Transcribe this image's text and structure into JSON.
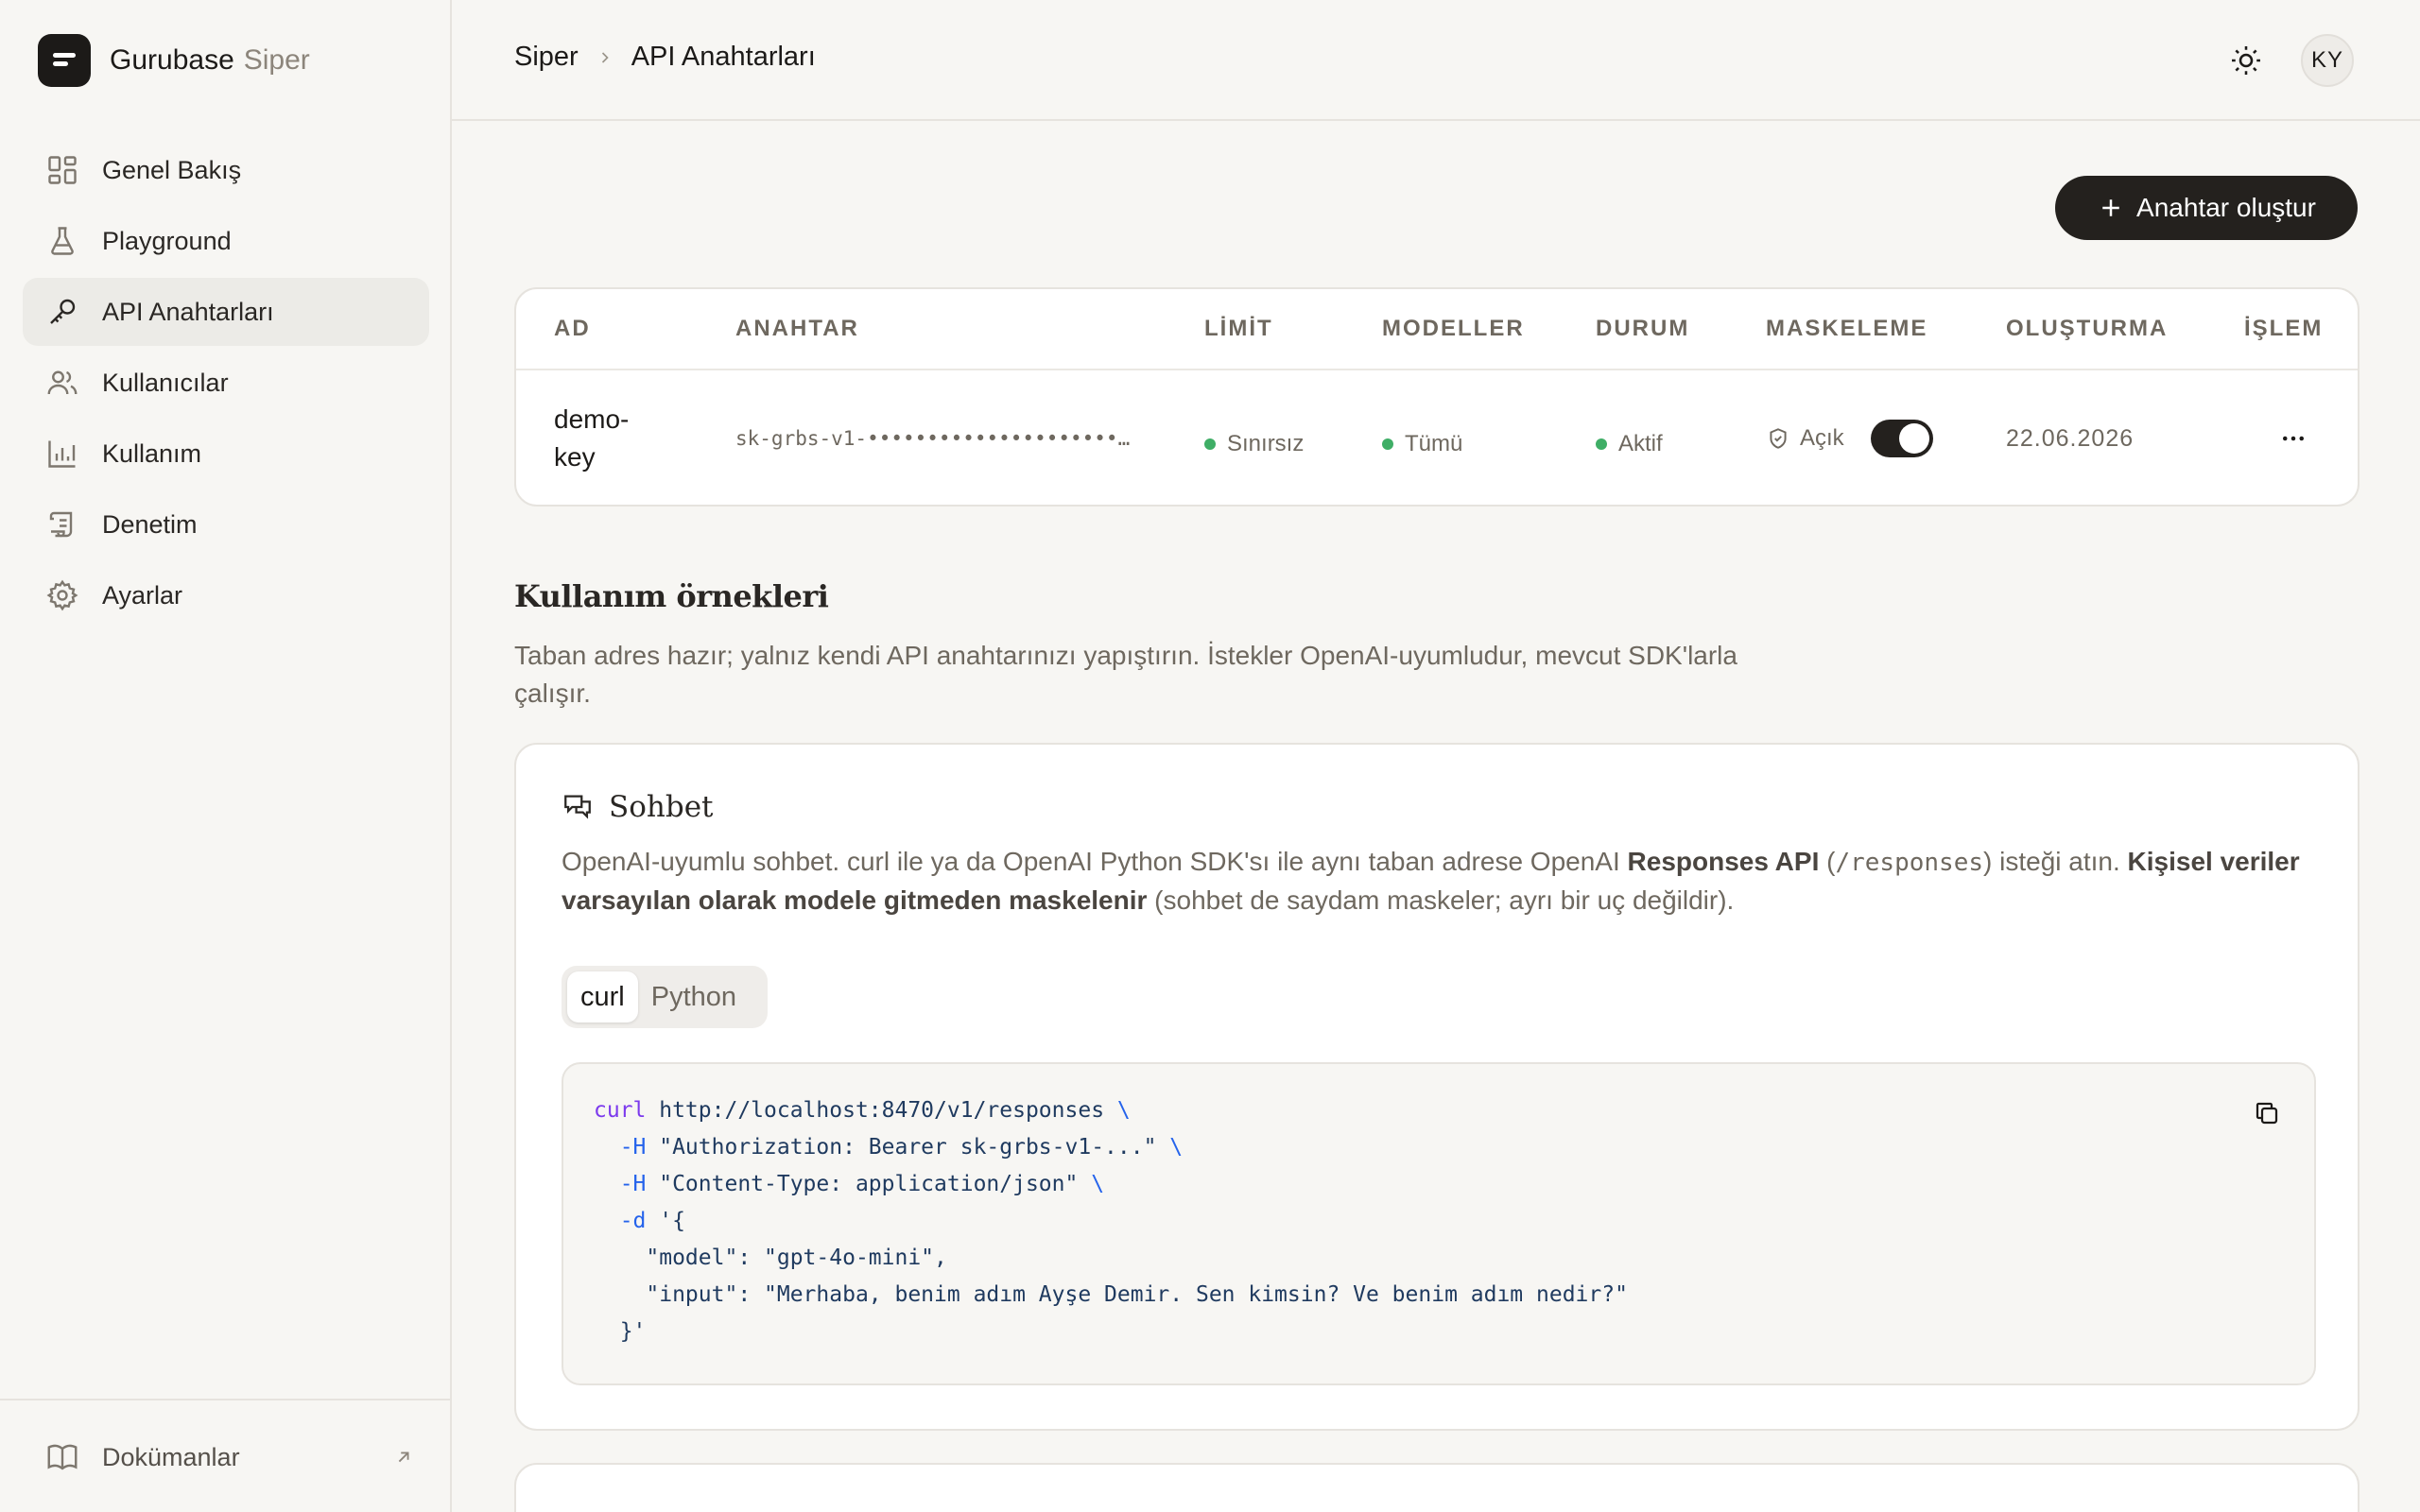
{
  "brand": {
    "name": "Gurubase",
    "sub": "Siper"
  },
  "sidebar": {
    "items": [
      {
        "label": "Genel Bakış",
        "icon": "dashboard-icon"
      },
      {
        "label": "Playground",
        "icon": "flask-icon"
      },
      {
        "label": "API Anahtarları",
        "icon": "key-icon"
      },
      {
        "label": "Kullanıcılar",
        "icon": "users-icon"
      },
      {
        "label": "Kullanım",
        "icon": "bar-chart-icon"
      },
      {
        "label": "Denetim",
        "icon": "scroll-icon"
      },
      {
        "label": "Ayarlar",
        "icon": "gear-icon"
      }
    ],
    "active_index": 2,
    "footer": {
      "label": "Dokümanlar"
    }
  },
  "header": {
    "breadcrumb_root": "Siper",
    "breadcrumb_current": "API Anahtarları",
    "avatar": "KY"
  },
  "actions": {
    "create_label": "Anahtar oluştur"
  },
  "table": {
    "headers": [
      "AD",
      "ANAHTAR",
      "LİMİT",
      "MODELLER",
      "DURUM",
      "MASKELEME",
      "OLUŞTURMA",
      "İŞLEM"
    ],
    "rows": [
      {
        "name": "demo-key",
        "key": "sk-grbs-v1-•••••••••••••••••••••••",
        "limit": "Sınırsız",
        "models": "Tümü",
        "status": "Aktif",
        "masking": "Açık",
        "masking_on": true,
        "created": "22.06.2026"
      }
    ]
  },
  "usage": {
    "title": "Kullanım örnekleri",
    "desc": "Taban adres hazır; yalnız kendi API anahtarınızı yapıştırın. İstekler OpenAI-uyumludur, mevcut SDK'larla çalışır."
  },
  "chat": {
    "title": "Sohbet",
    "desc_1": "OpenAI-uyumlu sohbet. curl ile ya da OpenAI Python SDK'sı ile aynı taban adrese OpenAI ",
    "desc_bold_1": "Responses API",
    "desc_2": " (",
    "desc_code": "/responses",
    "desc_3": ") isteği atın. ",
    "desc_bold_2": "Kişisel veriler varsayılan olarak modele gitmeden maskelenir",
    "desc_4": " (sohbet de saydam maskeler; ayrı bir uç değildir).",
    "tabs": [
      "curl",
      "Python"
    ],
    "active_tab": 0,
    "code": {
      "l1_cmd": "curl",
      "l1_url": " http://localhost:8470/v1/responses ",
      "cont": "\\",
      "l2_flag": "  -H",
      "l2_val": " \"Authorization: Bearer sk-grbs-v1-...\" ",
      "l3_flag": "  -H",
      "l3_val": " \"Content-Type: application/json\" ",
      "l4_flag": "  -d",
      "l4_val": " '{",
      "l5": "    \"model\": \"gpt-4o-mini\",",
      "l6": "    \"input\": \"Merhaba, benim adım Ayşe Demir. Sen kimsin? Ve benim adım nedir?\"",
      "l7": "  }'"
    }
  },
  "colors": {
    "accent": "#24211e",
    "status_green": "#3fae66",
    "background": "#f7f6f3"
  }
}
